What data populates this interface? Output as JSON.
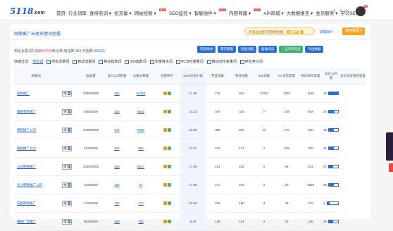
{
  "header": {
    "logo_main": "5118",
    "logo_suffix": ".com",
    "nav": [
      {
        "label": "首页",
        "hot": ""
      },
      {
        "label": "行业词库",
        "hot": ""
      },
      {
        "label": "查排名词 ▾",
        "hot": ""
      },
      {
        "label": "挖流量 ▾",
        "hot": ""
      },
      {
        "label": "网站挖掘 ▾",
        "hot": "NEW"
      },
      {
        "label": "SEO监控 ▾",
        "hot": ""
      },
      {
        "label": "智能插件 ▾",
        "hot": "NEW"
      },
      {
        "label": "内容神器 ▾",
        "hot": "NEW"
      },
      {
        "label": "API商城 ▾",
        "hot": ""
      },
      {
        "label": "大数据报告 ▾",
        "hot": ""
      },
      {
        "label": "会员服务 ▾",
        "hot": ""
      },
      {
        "label": "学习SEO ▾",
        "hot": ""
      }
    ],
    "badge": "99"
  },
  "page": {
    "breadcrumb": "网络推广长尾关键词挖掘",
    "promo_text": "开通企业版可无限制挖掘",
    "promo_btn": "立即开通",
    "getapi": "获取API",
    "tutorial": "使用教程 ▾",
    "stats_prefix": "相关长尾词共找到",
    "stats_count": "93769",
    "stats_mid": "条记录(有指数:",
    "stats_index": "153",
    "stats_mid2": " 无指数:",
    "stats_noindex": "93616",
    "stats_suffix": ")"
  },
  "buttons": [
    {
      "label": "内容规划",
      "color": "#2b6fd4"
    },
    {
      "label": "需求图谱",
      "color": "#2b6fd4"
    },
    {
      "label": "智能词图",
      "color": "#2b6fd4"
    },
    {
      "label": "智能问词",
      "color": "#2b6fd4"
    },
    {
      "label": "+ 五四词导出",
      "color": "#3cb371"
    },
    {
      "label": "导出数据",
      "color": "#2b6fd4"
    }
  ],
  "filters": {
    "label": "快捷过滤:",
    "selected": "所有词",
    "options": [
      "所有流量词",
      "移动流量词",
      "移动指数词",
      "360指数词",
      "流量特点词",
      "PC日检索量词",
      "移动日检索量词",
      "存在竞价词"
    ]
  },
  "table": {
    "headers": [
      "关键词",
      "",
      "收录量",
      "竞价公司数量",
      "长尾词数量",
      "流量特点",
      "SEM点击价格",
      "百度指数",
      "移动指数",
      "360指数",
      "PC日检索量",
      "移动日检索量",
      "竞价公司数",
      "竞价竞争激烈程度"
    ],
    "rows": [
      {
        "kw": "网络推广",
        "dd": "搜",
        "sl": "100000000",
        "jj": "385",
        "cw": "93290",
        "sem": "11.68",
        "bd": "776",
        "yd": "634",
        "s360": "2263",
        "pc": "1532",
        "ydr": "1156",
        "jjs": "13",
        "comp": 0.6
      },
      {
        "kw": "网络营销推广",
        "dd": "搜",
        "sl": "50800000",
        "jj": "352",
        "cw": "6552",
        "sem": "10.23",
        "bd": "487",
        "yd": "425",
        "s360": "77",
        "pc": "108",
        "ydr": "939",
        "jjs": "20",
        "comp": 0.35
      },
      {
        "kw": "网络推广公司",
        "dd": "搜",
        "sl": "100000000",
        "jj": "241",
        "cw": "6008",
        "sem": "24.39",
        "bd": "368",
        "yd": "292",
        "s360": "12",
        "pc": "175",
        "ydr": "500",
        "jjs": "19",
        "comp": 0.3
      },
      {
        "kw": "网络推广外包",
        "dd": "搜",
        "sl": "21200000",
        "jj": "362",
        "cw": "896",
        "sem": "11.07",
        "bd": "232",
        "yd": "171",
        "s360": "1",
        "pc": "109",
        "ydr": "320",
        "jjs": "21",
        "comp": 0.3
      },
      {
        "kw": "公司网络推广",
        "dd": "搜",
        "sl": "100000000",
        "jj": "365",
        "cw": "8027",
        "sem": "17.50",
        "bd": "231",
        "yd": "180",
        "s360": "0",
        "pc": "54",
        "ydr": "551",
        "jjs": "27",
        "comp": 0.25
      },
      {
        "kw": "长沙网络推广公司",
        "dd": "搜",
        "sl": "10200000",
        "jj": "152",
        "cw": "67",
        "sem": "17.59",
        "bd": "217",
        "yd": "184",
        "s360": "0",
        "pc": "20",
        "ydr": "1559",
        "jjs": "25",
        "comp": 0.3
      },
      {
        "kw": "成都网络推广",
        "dd": "搜",
        "sl": "17200000",
        "jj": "162",
        "cw": "473",
        "sem": "13.03",
        "bd": "201",
        "yd": "150",
        "s360": "0",
        "pc": "48",
        "ydr": "276",
        "jjs": "4",
        "comp": 0.15
      },
      {
        "kw": "网络广告推广",
        "dd": "搜",
        "sl": "95100000",
        "jj": "388",
        "cw": "782",
        "sem": "8.40",
        "bd": "169",
        "yd": "114",
        "s360": "0",
        "pc": "33",
        "ydr": "156",
        "jjs": "20",
        "comp": 0.25
      }
    ]
  }
}
